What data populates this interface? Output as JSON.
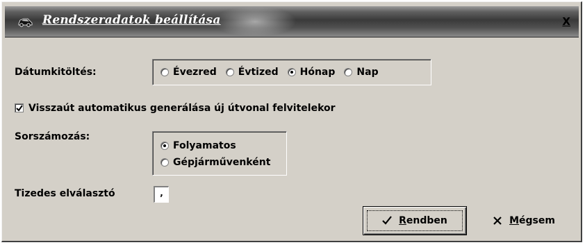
{
  "dialog": {
    "title": "Rendszeradatok beállítása",
    "close_label": "X",
    "title_icon": "car-icon"
  },
  "date_fill": {
    "label": "Dátumkitöltés:",
    "options": [
      {
        "label": "Évezred",
        "checked": false
      },
      {
        "label": "Évtized",
        "checked": false
      },
      {
        "label": "Hónap",
        "checked": true
      },
      {
        "label": "Nap",
        "checked": false
      }
    ]
  },
  "auto_return": {
    "label": "Visszaút automatikus generálása új útvonal felvitelekor",
    "checked": true
  },
  "numbering": {
    "label": "Sorszámozás:",
    "options": [
      {
        "label": "Folyamatos",
        "checked": true
      },
      {
        "label": "Gépjárművenként",
        "checked": false
      }
    ]
  },
  "decimal_separator": {
    "label": "Tizedes elválasztó",
    "value": ","
  },
  "buttons": {
    "ok_first": "R",
    "ok_rest": "endben",
    "cancel_first": "M",
    "cancel_rest": "égsem"
  }
}
